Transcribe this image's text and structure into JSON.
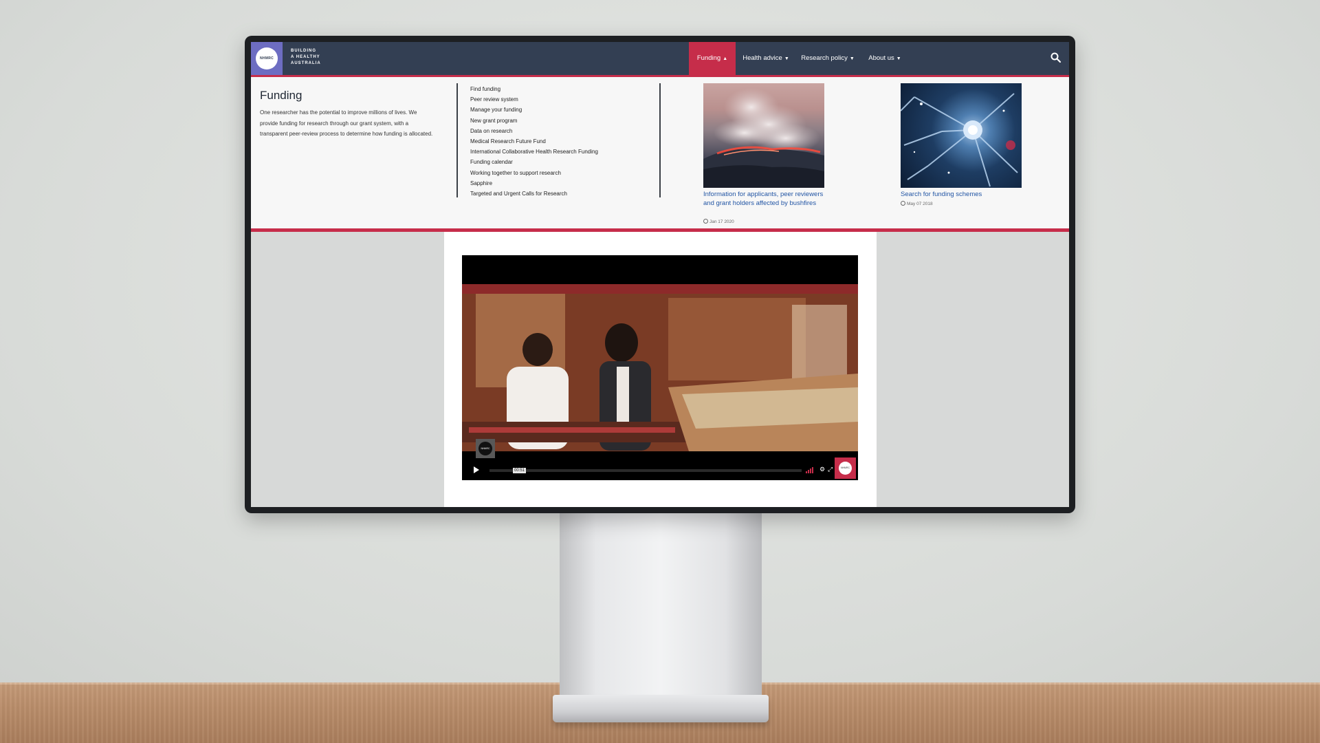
{
  "brand": {
    "logo_text": "NHMRC",
    "tagline": [
      "BUILDING",
      "A HEALTHY",
      "AUSTRALIA"
    ]
  },
  "nav": {
    "items": [
      {
        "label": "Funding",
        "active": true
      },
      {
        "label": "Health advice",
        "active": false
      },
      {
        "label": "Research policy",
        "active": false
      },
      {
        "label": "About us",
        "active": false
      }
    ],
    "search_icon": "search-icon"
  },
  "funding_menu": {
    "title": "Funding",
    "description": "One researcher has the potential to improve millions of lives. We provide funding for research through our grant system, with a transparent peer-review process to determine how funding is allocated.",
    "links": [
      "Find funding",
      "Peer review system",
      "Manage your funding",
      "New grant program",
      "Data on research",
      "Medical Research Future Fund",
      "International Collaborative Health Research Funding",
      "Funding calendar",
      "Working together to support research",
      "Sapphire",
      "Targeted and Urgent Calls for Research"
    ],
    "cards": [
      {
        "title": "Information for applicants, peer reviewers and grant holders affected by bushfires",
        "date": "Jan 17 2020",
        "image": "bushfire-photo"
      },
      {
        "title": "Search for funding schemes",
        "date": "May 07 2018",
        "image": "neuron-illustration"
      }
    ]
  },
  "video": {
    "channel_logo_text": "NHMRC",
    "timestamp": "00:51",
    "badge_text": "NHMRC",
    "icons": [
      "play-icon",
      "volume-icon",
      "settings-icon",
      "fullscreen-icon"
    ]
  },
  "colors": {
    "nav_bg": "#333f53",
    "accent": "#c62d4a",
    "logo_bg": "#6d6dc2",
    "link": "#2255a4"
  }
}
